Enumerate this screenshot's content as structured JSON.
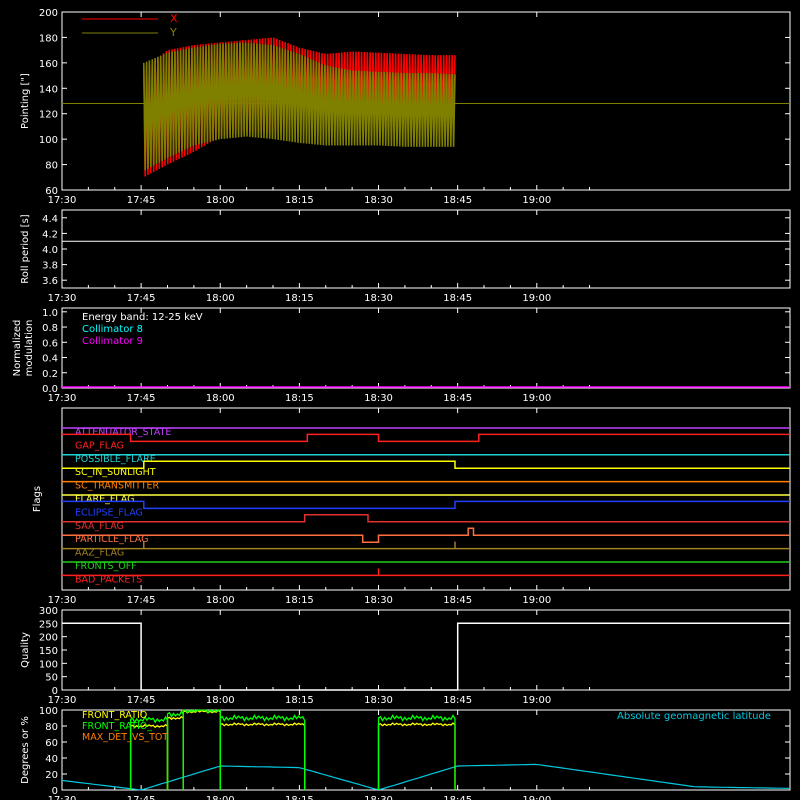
{
  "x_axis": {
    "ticks": [
      "17:30",
      "17:45",
      "18:00",
      "18:15",
      "18:30",
      "18:45",
      "19:00"
    ],
    "range_minutes": [
      "17:30",
      "19:48"
    ]
  },
  "panels": {
    "pointing": {
      "ylabel": "Pointing [\"]",
      "yticks": [
        "60",
        "80",
        "100",
        "120",
        "140",
        "160",
        "180",
        "200"
      ],
      "legend": [
        {
          "name": "X",
          "color": "#ff0000"
        },
        {
          "name": "Y",
          "color": "#808000"
        }
      ]
    },
    "roll": {
      "ylabel": "Roll period [s]",
      "yticks": [
        "3.6",
        "3.8",
        "4.0",
        "4.2",
        "4.4"
      ]
    },
    "modulation": {
      "ylabel_line1": "Normalized",
      "ylabel_line2": "modulation",
      "yticks": [
        "0.0",
        "0.2",
        "0.4",
        "0.6",
        "0.8",
        "1.0"
      ],
      "legend": [
        {
          "name": "Energy band: 12-25 keV",
          "color": "#ffffff"
        },
        {
          "name": "Collimator 8",
          "color": "#00ffff"
        },
        {
          "name": "Collimator 9",
          "color": "#ff00ff"
        }
      ]
    },
    "flags": {
      "ylabel": "Flags",
      "items": [
        {
          "name": "ATTENUATOR_STATE",
          "color": "#c040ff"
        },
        {
          "name": "GAP_FLAG",
          "color": "#ff2020"
        },
        {
          "name": "POSSIBLE_FLARE",
          "color": "#20d0d0"
        },
        {
          "name": "SC_IN_SUNLIGHT",
          "color": "#ffff00"
        },
        {
          "name": "SC_TRANSMITTER",
          "color": "#ff8000"
        },
        {
          "name": "FLARE_FLAG",
          "color": "#ffff40"
        },
        {
          "name": "ECLIPSE_FLAG",
          "color": "#2040ff"
        },
        {
          "name": "SAA_FLAG",
          "color": "#e03030"
        },
        {
          "name": "PARTICLE_FLAG",
          "color": "#ff7040"
        },
        {
          "name": "AAZ_FLAG",
          "color": "#a08020"
        },
        {
          "name": "FRONTS_OFF",
          "color": "#20d020"
        },
        {
          "name": "BAD_PACKETS",
          "color": "#ff2020"
        }
      ]
    },
    "quality": {
      "ylabel": "Quality",
      "yticks": [
        "0",
        "50",
        "100",
        "150",
        "200",
        "250",
        "300"
      ]
    },
    "ratio": {
      "ylabel": "Degrees or %",
      "yticks": [
        "0",
        "20",
        "40",
        "60",
        "80",
        "100"
      ],
      "legend": [
        {
          "name": "FRONT_RATIO",
          "color": "#ffff00"
        },
        {
          "name": "FRONT_RATIO_",
          "color": "#00ff00"
        },
        {
          "name": "MAX_DET_VS_TOT",
          "color": "#ff8000"
        }
      ],
      "right_label": "Absolute geomagnetic latitude",
      "right_label_color": "#00c8e0"
    }
  },
  "chart_data": [
    {
      "type": "line",
      "title": "",
      "xlabel": "",
      "ylabel": "Pointing [\"]",
      "ylim": [
        60,
        200
      ],
      "series": [
        {
          "name": "X",
          "x": [
            "17:45.5",
            "17:50",
            "17:55",
            "18:00",
            "18:05",
            "18:10",
            "18:15",
            "18:20",
            "18:25",
            "18:30",
            "18:35",
            "18:40",
            "18:44.5"
          ],
          "upper": [
            155,
            170,
            174,
            176,
            178,
            180,
            172,
            167,
            169,
            168,
            167,
            166,
            166
          ],
          "lower": [
            70,
            80,
            90,
            102,
            106,
            104,
            117,
            118,
            117,
            116,
            116,
            116,
            117
          ]
        },
        {
          "name": "Y",
          "x": [
            "17:45.5",
            "17:50",
            "17:55",
            "18:00",
            "18:05",
            "18:10",
            "18:15",
            "18:20",
            "18:25",
            "18:30",
            "18:35",
            "18:40",
            "18:44.5"
          ],
          "upper": [
            160,
            168,
            172,
            175,
            176,
            174,
            167,
            158,
            154,
            153,
            152,
            152,
            151
          ],
          "lower": [
            75,
            85,
            95,
            100,
            102,
            100,
            97,
            95,
            95,
            95,
            94,
            94,
            94
          ],
          "baseline": 128
        }
      ]
    },
    {
      "type": "line",
      "ylabel": "Roll period [s]",
      "ylim": [
        3.5,
        4.5
      ],
      "series": [
        {
          "name": "",
          "x": [
            "17:30",
            "19:48"
          ],
          "values": [
            4.1,
            4.1
          ]
        }
      ]
    },
    {
      "type": "line",
      "ylabel": "Normalized modulation",
      "ylim": [
        0,
        1.05
      ],
      "series": [
        {
          "name": "Collimator 8",
          "x": [
            "17:30",
            "19:48"
          ],
          "values": [
            0.0,
            0.0
          ]
        },
        {
          "name": "Collimator 9",
          "x": [
            "17:30",
            "19:48"
          ],
          "values": [
            0.0,
            0.0
          ]
        }
      ]
    },
    {
      "type": "line",
      "ylabel": "Flags",
      "series": [
        {
          "name": "ATTENUATOR_STATE",
          "steps": [
            [
              "17:30",
              0
            ]
          ]
        },
        {
          "name": "GAP_FLAG",
          "steps": [
            [
              "17:30",
              1
            ],
            [
              "17:43",
              0
            ],
            [
              "18:16.5",
              1
            ],
            [
              "18:30",
              0
            ],
            [
              "18:49",
              1
            ]
          ]
        },
        {
          "name": "POSSIBLE_FLARE",
          "steps": [
            [
              "17:30",
              0
            ]
          ]
        },
        {
          "name": "SC_IN_SUNLIGHT",
          "steps": [
            [
              "17:30",
              0
            ],
            [
              "17:45.5",
              1
            ],
            [
              "18:44.5",
              0
            ]
          ]
        },
        {
          "name": "SC_TRANSMITTER",
          "steps": [
            [
              "17:30",
              0
            ]
          ]
        },
        {
          "name": "FLARE_FLAG",
          "steps": [
            [
              "17:30",
              0
            ]
          ]
        },
        {
          "name": "ECLIPSE_FLAG",
          "steps": [
            [
              "17:30",
              1
            ],
            [
              "17:45.5",
              0
            ],
            [
              "18:44.5",
              1
            ]
          ]
        },
        {
          "name": "SAA_FLAG",
          "steps": [
            [
              "17:30",
              0
            ],
            [
              "18:16",
              1
            ],
            [
              "18:28",
              0
            ]
          ]
        },
        {
          "name": "PARTICLE_FLAG",
          "steps": [
            [
              "17:30",
              0
            ],
            [
              "18:27",
              -1
            ],
            [
              "18:30",
              0
            ],
            [
              "18:47",
              1
            ],
            [
              "18:48",
              0
            ]
          ]
        },
        {
          "name": "AAZ_FLAG",
          "steps": [
            [
              "17:30",
              0
            ]
          ],
          "spikes": [
            "17:45.5",
            "18:44.5"
          ]
        },
        {
          "name": "FRONTS_OFF",
          "steps": [
            [
              "17:30",
              0
            ]
          ]
        },
        {
          "name": "BAD_PACKETS",
          "steps": [
            [
              "17:30",
              0
            ]
          ],
          "spikes": [
            "18:30"
          ]
        }
      ]
    },
    {
      "type": "line",
      "ylabel": "Quality",
      "ylim": [
        0,
        300
      ],
      "series": [
        {
          "name": "",
          "steps": [
            [
              "17:30",
              250
            ],
            [
              "17:45",
              0
            ],
            [
              "18:45",
              250
            ]
          ]
        }
      ]
    },
    {
      "type": "line",
      "ylabel": "Degrees or %",
      "ylim": [
        0,
        100
      ],
      "series": [
        {
          "name": "FRONT_RATIO",
          "segments": [
            [
              "17:43",
              "17:50",
              80
            ],
            [
              "17:50",
              "17:53",
              90
            ],
            [
              "17:53",
              "18:00",
              98
            ],
            [
              "18:00",
              "18:16",
              82
            ],
            [
              "18:30",
              "18:44.5",
              82
            ]
          ]
        },
        {
          "name": "FRONT_RATIO_",
          "segments": [
            [
              "17:43",
              "17:50",
              88
            ],
            [
              "17:50",
              "17:53",
              95
            ],
            [
              "17:53",
              "18:00",
              100
            ],
            [
              "18:00",
              "18:16",
              90
            ],
            [
              "18:30",
              "18:44.5",
              90
            ]
          ]
        },
        {
          "name": "Absolute geomagnetic latitude",
          "x": [
            "17:30",
            "17:45",
            "18:00",
            "18:15",
            "18:30",
            "18:45",
            "19:00",
            "19:15",
            "19:30",
            "19:48"
          ],
          "values": [
            12,
            0,
            30,
            28,
            0,
            30,
            32,
            18,
            4,
            2
          ]
        }
      ]
    }
  ]
}
